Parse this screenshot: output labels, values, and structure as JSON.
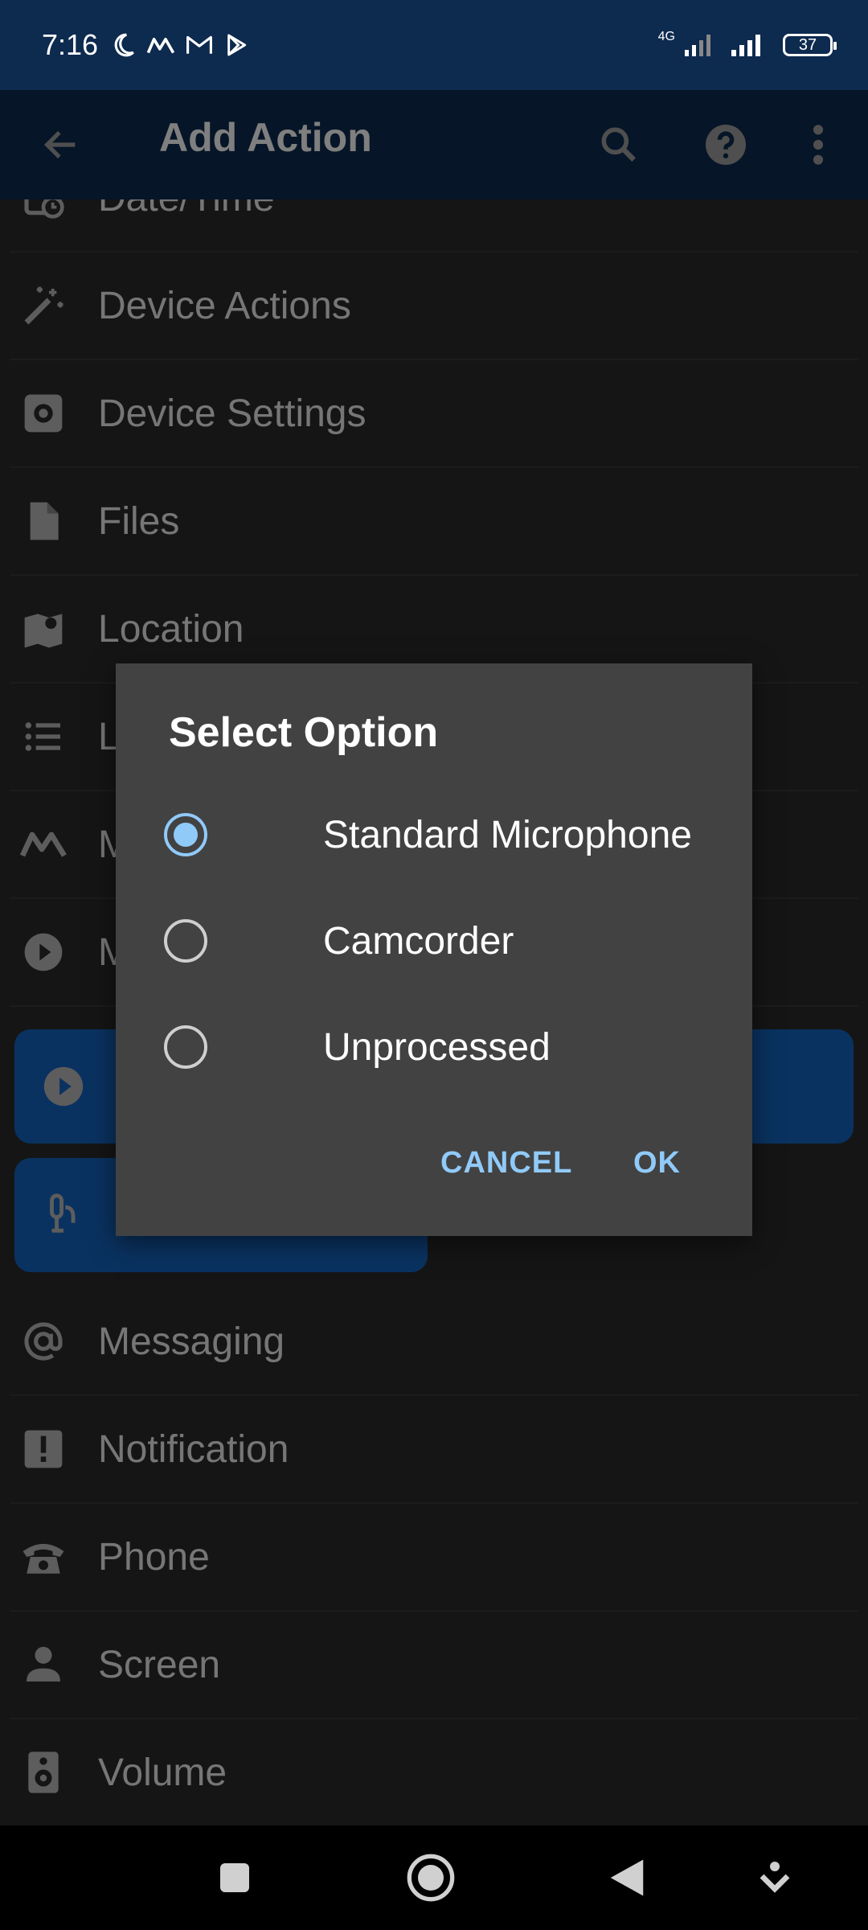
{
  "status_bar": {
    "time": "7:16",
    "network": "4G",
    "battery": "37"
  },
  "app_bar": {
    "title": "Add Action"
  },
  "list_items": [
    {
      "label": "Date/Time",
      "icon": "calendar-clock-icon"
    },
    {
      "label": "Device Actions",
      "icon": "magic-wand-icon"
    },
    {
      "label": "Device Settings",
      "icon": "gear-icon"
    },
    {
      "label": "Files",
      "icon": "file-icon"
    },
    {
      "label": "Location",
      "icon": "map-pin-icon"
    },
    {
      "label": "L",
      "icon": "list-icon"
    },
    {
      "label": "M",
      "icon": "macrodroid-icon"
    },
    {
      "label": "M",
      "icon": "play-circle-icon"
    },
    {
      "label": "Messaging",
      "icon": "at-icon"
    },
    {
      "label": "Notification",
      "icon": "alert-icon"
    },
    {
      "label": "Phone",
      "icon": "phone-icon"
    },
    {
      "label": "Screen",
      "icon": "person-icon"
    },
    {
      "label": "Volume",
      "icon": "speaker-icon"
    }
  ],
  "dialog": {
    "title": "Select Option",
    "options": [
      {
        "label": "Standard Microphone",
        "selected": true
      },
      {
        "label": "Camcorder",
        "selected": false
      },
      {
        "label": "Unprocessed",
        "selected": false
      }
    ],
    "cancel_label": "CANCEL",
    "ok_label": "OK"
  },
  "colors": {
    "app_bar": "#0d2a4f",
    "accent": "#90caf9",
    "dialog": "#424242",
    "highlight": "#1565c0"
  }
}
